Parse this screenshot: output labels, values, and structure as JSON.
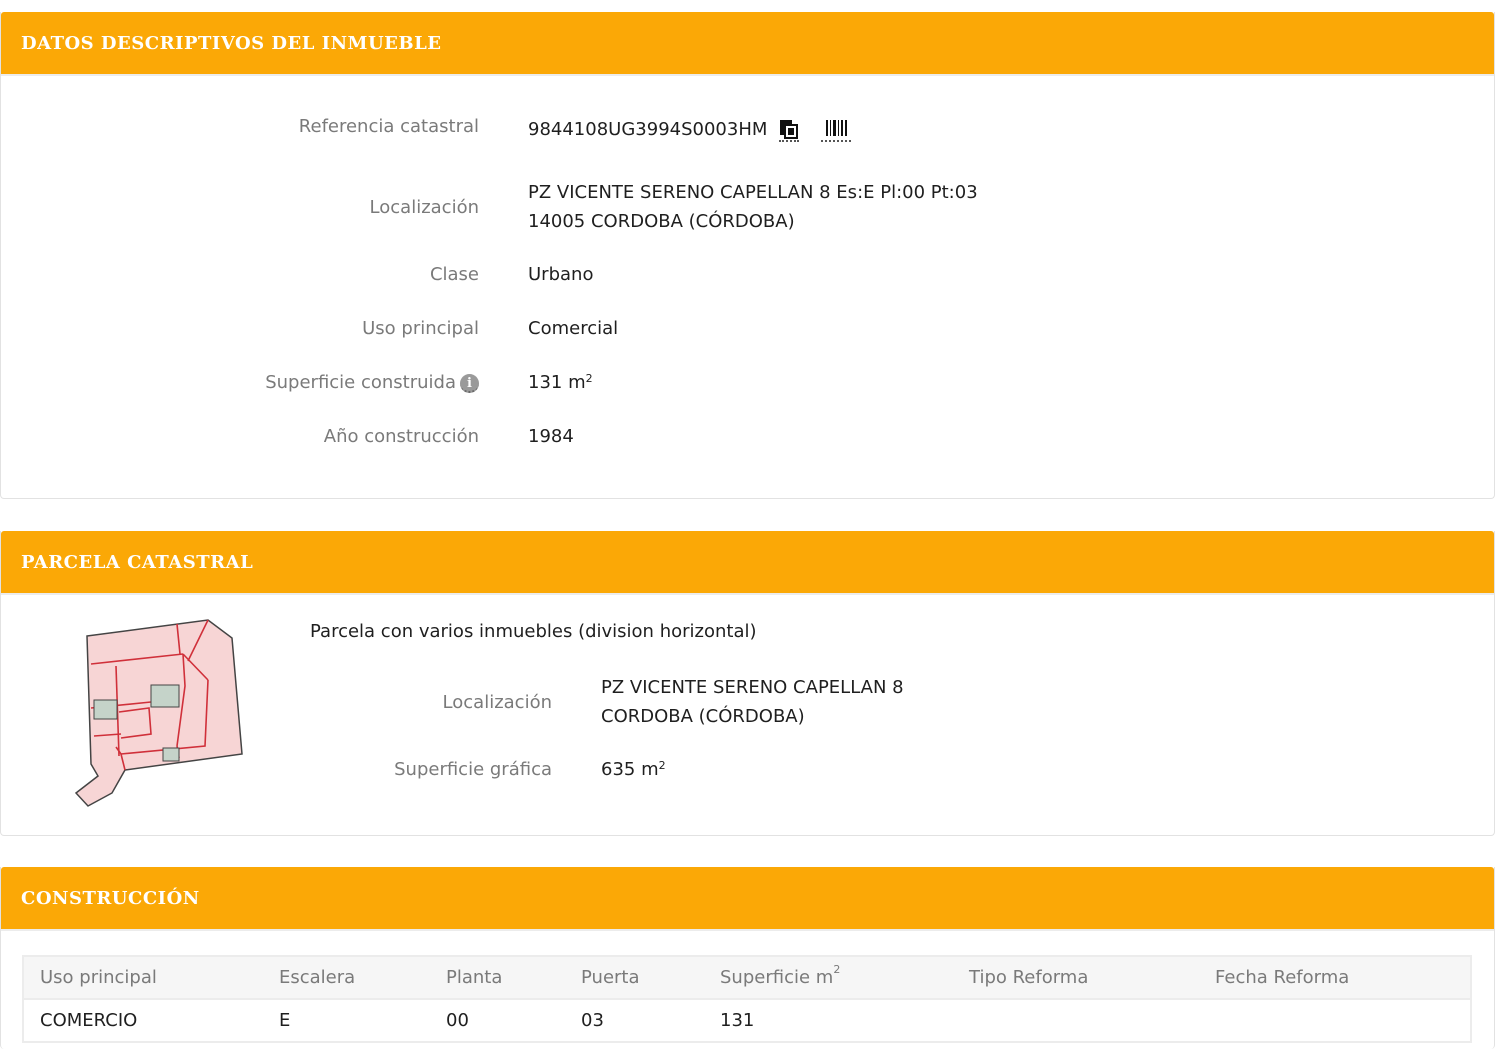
{
  "datos": {
    "title": "DATOS DESCRIPTIVOS DEL INMUEBLE",
    "referencia_label": "Referencia catastral",
    "referencia_value": "9844108UG3994S0003HM",
    "localizacion_label": "Localización",
    "localizacion_line1": "PZ VICENTE SERENO CAPELLAN 8 Es:E Pl:00 Pt:03",
    "localizacion_line2": "14005 CORDOBA (CÓRDOBA)",
    "clase_label": "Clase",
    "clase_value": "Urbano",
    "uso_label": "Uso principal",
    "uso_value": "Comercial",
    "superficie_label": "Superficie construida",
    "superficie_value": "131 m",
    "superficie_unit_exp": "2",
    "anio_label": "Año construcción",
    "anio_value": "1984"
  },
  "parcela": {
    "title": "PARCELA CATASTRAL",
    "description": "Parcela con varios inmuebles (division horizontal)",
    "localizacion_label": "Localización",
    "localizacion_line1": "PZ VICENTE SERENO CAPELLAN 8",
    "localizacion_line2": "CORDOBA (CÓRDOBA)",
    "superficie_label": "Superficie gráfica",
    "superficie_value": "635 m",
    "superficie_unit_exp": "2"
  },
  "construccion": {
    "title": "CONSTRUCCIÓN",
    "headers": {
      "uso": "Uso principal",
      "escalera": "Escalera",
      "planta": "Planta",
      "puerta": "Puerta",
      "superficie": "Superficie m",
      "superficie_exp": "2",
      "tipo_reforma": "Tipo Reforma",
      "fecha_reforma": "Fecha Reforma"
    },
    "rows": [
      {
        "uso": "COMERCIO",
        "escalera": "E",
        "planta": "00",
        "puerta": "03",
        "superficie": "131",
        "tipo_reforma": "",
        "fecha_reforma": ""
      }
    ]
  },
  "icons": {
    "info": "i",
    "copy": "copy-icon",
    "barcode": "barcode-icon",
    "info_icon": "info-icon"
  },
  "colors": {
    "header": "#fba806",
    "parcel_fill": "#f7d5d5",
    "parcel_line": "#d0303a",
    "parcel_patch": "#c5d3c9"
  }
}
